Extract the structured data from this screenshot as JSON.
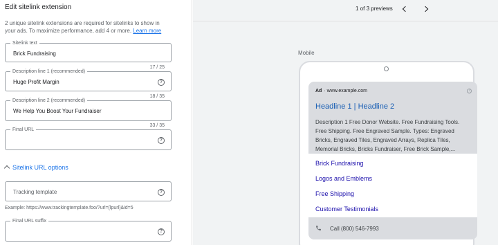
{
  "editor": {
    "title": "Edit sitelink extension",
    "intro_text": "2 unique sitelink extensions are required for sitelinks to show in your ads. To maximize performance, add 4 or more.",
    "learn_more": "Learn more",
    "sitelink_text": {
      "label": "Sitelink text",
      "value": "Brick Fundraising"
    },
    "desc1": {
      "label": "Description line 1 (recommended)",
      "value": "Huge Profit Margin",
      "counter": "17 / 25"
    },
    "desc2": {
      "label": "Description line 2 (recommended)",
      "value": "We Help You Boost Your Fundraiser",
      "counter": "18 / 35"
    },
    "final_url": {
      "label": "Final URL",
      "value": "",
      "counter": "33 / 35"
    },
    "url_options_label": "Sitelink URL options",
    "tracking_template": {
      "placeholder": "Tracking template"
    },
    "tracking_example": "Example: https://www.trackingtemplate.foo/?url={lpurl}&id=5",
    "final_url_suffix": {
      "label": "Final URL suffix",
      "value": ""
    }
  },
  "preview": {
    "counter_text": "1 of 3 previews",
    "device_label": "Mobile",
    "ad_badge": "Ad",
    "ad_url": "· www.example.com",
    "headline": "Headline 1 | Headline 2",
    "description": "Description 1 Free Donor Website. Free Fundraising Tools. Free Shipping. Free Engraved Sample. Types: Engraved Bricks, Engraved Tiles, Engraved Arrays, Replica Tiles, Memorial Bricks, Bricks Fundraiser, Free Brick Sample,...",
    "sitelinks": [
      "Brick Fundraising",
      "Logos and Emblems",
      "Free Shipping",
      "Customer Testimonials"
    ],
    "call_text": "Call (800) 546-7993"
  },
  "icons": {
    "help": "help-circle-icon",
    "prev": "chevron-left-icon",
    "next": "chevron-right-icon",
    "expand": "chevron-up-icon",
    "call": "phone-icon",
    "info": "info-icon"
  }
}
